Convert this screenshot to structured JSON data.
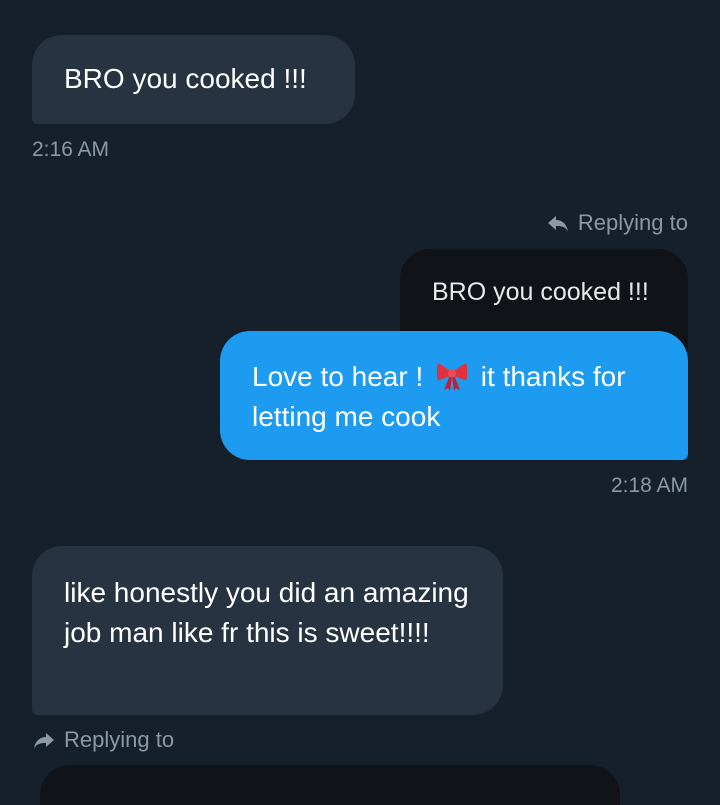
{
  "messages": [
    {
      "direction": "received",
      "text": "BRO you cooked !!!",
      "time": "2:16 AM"
    },
    {
      "direction": "sent",
      "replying_label": "Replying to",
      "quoted_text": "BRO you cooked !!!",
      "text_before_emoji": "Love to hear ! ",
      "emoji": "ribbon-icon",
      "text_after_emoji": " it thanks for letting me cook",
      "time": "2:18 AM"
    },
    {
      "direction": "received",
      "text": "like honestly you did an amazing job man like fr this is sweet!!!!",
      "replying_label": "Replying to"
    }
  ],
  "colors": {
    "background": "#15202b",
    "received_bubble": "#273340",
    "sent_bubble": "#1d9bf0",
    "quoted_bubble": "#101419",
    "secondary_text": "#8b98a5"
  }
}
